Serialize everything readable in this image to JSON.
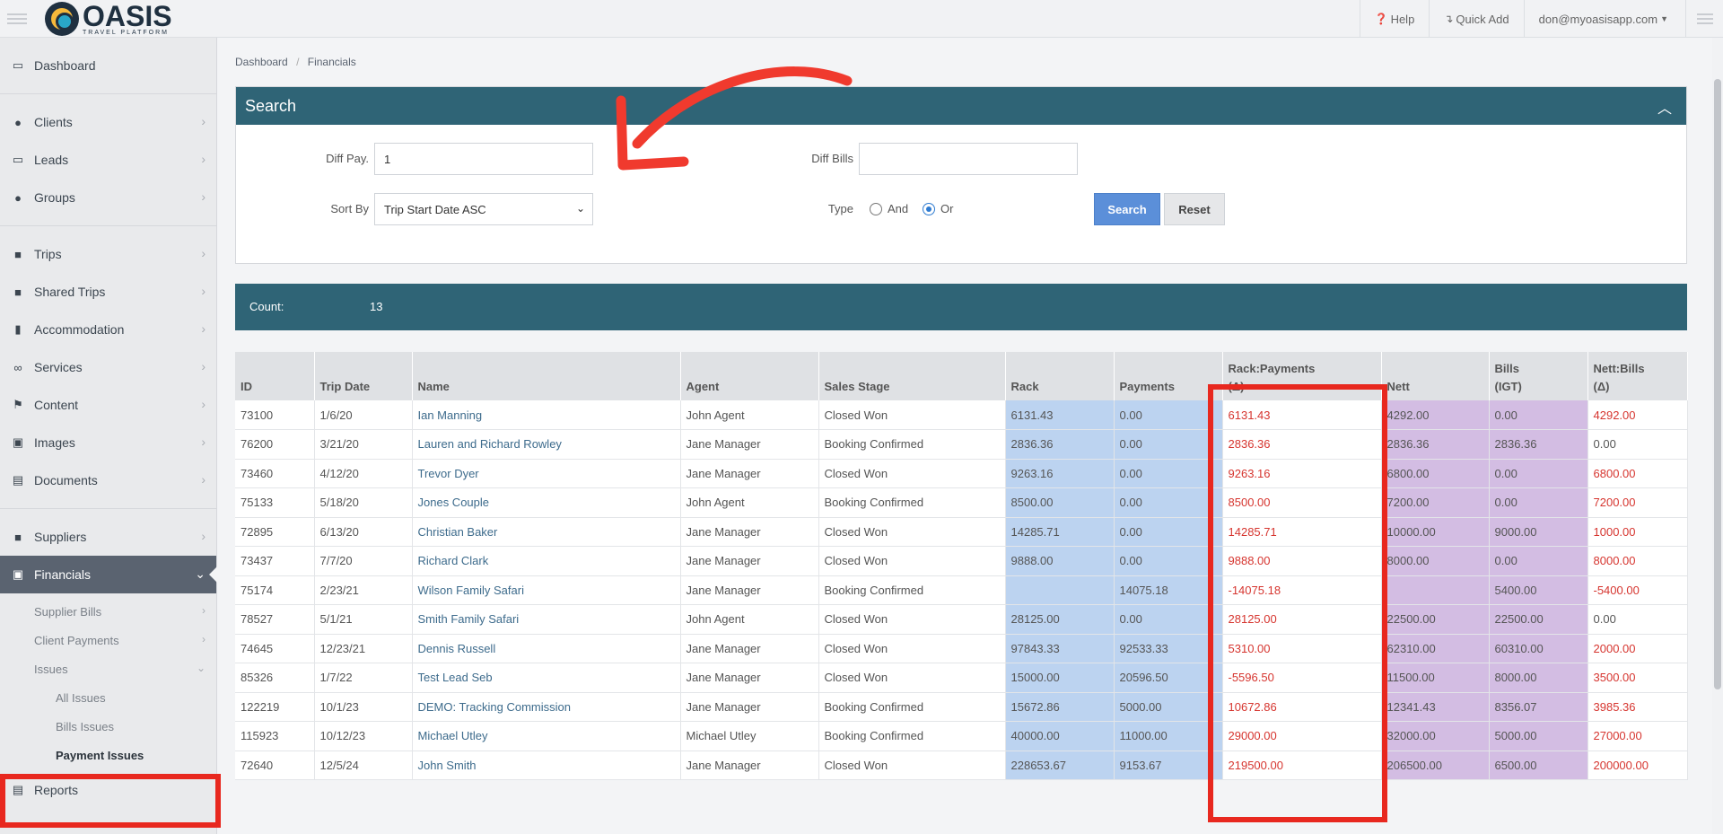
{
  "topbar": {
    "logo_word": "OASIS",
    "logo_sub": "TRAVEL PLATFORM",
    "help_label": "Help",
    "quick_add_label": "Quick Add",
    "user_email": "don@myoasisapp.com"
  },
  "sidebar": {
    "items": [
      {
        "label": "Dashboard",
        "icon": "monitor-icon"
      },
      {
        "label": "Clients",
        "icon": "user-icon"
      },
      {
        "label": "Leads",
        "icon": "inbox-icon"
      },
      {
        "label": "Groups",
        "icon": "users-icon"
      },
      {
        "label": "Trips",
        "icon": "briefcase-icon"
      },
      {
        "label": "Shared Trips",
        "icon": "briefcase-icon"
      },
      {
        "label": "Accommodation",
        "icon": "building-icon"
      },
      {
        "label": "Services",
        "icon": "binoculars-icon"
      },
      {
        "label": "Content",
        "icon": "flag-icon"
      },
      {
        "label": "Images",
        "icon": "image-icon"
      },
      {
        "label": "Documents",
        "icon": "document-icon"
      },
      {
        "label": "Suppliers",
        "icon": "truck-icon"
      },
      {
        "label": "Financials",
        "icon": "money-icon"
      },
      {
        "label": "Reports",
        "icon": "list-icon"
      }
    ],
    "sub_items": {
      "supplier_bills": "Supplier Bills",
      "client_payments": "Client Payments",
      "issues": "Issues",
      "all_issues": "All Issues",
      "bills_issues": "Bills Issues",
      "payment_issues": "Payment Issues"
    }
  },
  "breadcrumb": {
    "home": "Dashboard",
    "current": "Financials"
  },
  "search": {
    "title": "Search",
    "diff_pay_label": "Diff Pay.",
    "diff_pay_value": "1",
    "diff_bills_label": "Diff Bills",
    "diff_bills_value": "",
    "sort_by_label": "Sort By",
    "sort_by_value": "Trip Start Date ASC",
    "type_label": "Type",
    "type_and": "And",
    "type_or": "Or",
    "search_button": "Search",
    "reset_button": "Reset"
  },
  "count": {
    "label": "Count:",
    "value": "13"
  },
  "table": {
    "headers": {
      "id": "ID",
      "trip_date": "Trip Date",
      "name": "Name",
      "agent": "Agent",
      "sales_stage": "Sales Stage",
      "rack": "Rack",
      "payments": "Payments",
      "rack_payments_1": "Rack:Payments",
      "rack_payments_2": "(Δ)",
      "nett": "Nett",
      "bills_1": "Bills",
      "bills_2": "(IGT)",
      "nett_bills_1": "Nett:Bills",
      "nett_bills_2": "(Δ)"
    },
    "rows": [
      {
        "id": "73100",
        "date": "1/6/20",
        "name": "Ian Manning",
        "agent": "John Agent",
        "stage": "Closed Won",
        "rack": "6131.43",
        "pay": "0.00",
        "rp": "6131.43",
        "nett": "4292.00",
        "bills": "0.00",
        "nb": "4292.00",
        "nb_red": true
      },
      {
        "id": "76200",
        "date": "3/21/20",
        "name": "Lauren and Richard Rowley",
        "agent": "Jane Manager",
        "stage": "Booking Confirmed",
        "rack": "2836.36",
        "pay": "0.00",
        "rp": "2836.36",
        "nett": "2836.36",
        "bills": "2836.36",
        "nb": "0.00",
        "nb_red": false
      },
      {
        "id": "73460",
        "date": "4/12/20",
        "name": "Trevor Dyer",
        "agent": "Jane Manager",
        "stage": "Closed Won",
        "rack": "9263.16",
        "pay": "0.00",
        "rp": "9263.16",
        "nett": "6800.00",
        "bills": "0.00",
        "nb": "6800.00",
        "nb_red": true
      },
      {
        "id": "75133",
        "date": "5/18/20",
        "name": "Jones Couple",
        "agent": "John Agent",
        "stage": "Booking Confirmed",
        "rack": "8500.00",
        "pay": "0.00",
        "rp": "8500.00",
        "nett": "7200.00",
        "bills": "0.00",
        "nb": "7200.00",
        "nb_red": true
      },
      {
        "id": "72895",
        "date": "6/13/20",
        "name": "Christian Baker",
        "agent": "Jane Manager",
        "stage": "Closed Won",
        "rack": "14285.71",
        "pay": "0.00",
        "rp": "14285.71",
        "nett": "10000.00",
        "bills": "9000.00",
        "nb": "1000.00",
        "nb_red": true
      },
      {
        "id": "73437",
        "date": "7/7/20",
        "name": "Richard Clark",
        "agent": "Jane Manager",
        "stage": "Closed Won",
        "rack": "9888.00",
        "pay": "0.00",
        "rp": "9888.00",
        "nett": "8000.00",
        "bills": "0.00",
        "nb": "8000.00",
        "nb_red": true
      },
      {
        "id": "75174",
        "date": "2/23/21",
        "name": "Wilson Family Safari",
        "agent": "Jane Manager",
        "stage": "Booking Confirmed",
        "rack": "",
        "pay": "14075.18",
        "rp": "-14075.18",
        "nett": "",
        "bills": "5400.00",
        "nb": "-5400.00",
        "nb_red": true
      },
      {
        "id": "78527",
        "date": "5/1/21",
        "name": "Smith Family Safari",
        "agent": "John Agent",
        "stage": "Closed Won",
        "rack": "28125.00",
        "pay": "0.00",
        "rp": "28125.00",
        "nett": "22500.00",
        "bills": "22500.00",
        "nb": "0.00",
        "nb_red": false
      },
      {
        "id": "74645",
        "date": "12/23/21",
        "name": "Dennis Russell",
        "agent": "Jane Manager",
        "stage": "Closed Won",
        "rack": "97843.33",
        "pay": "92533.33",
        "rp": "5310.00",
        "nett": "62310.00",
        "bills": "60310.00",
        "nb": "2000.00",
        "nb_red": true
      },
      {
        "id": "85326",
        "date": "1/7/22",
        "name": "Test Lead Seb",
        "agent": "Jane Manager",
        "stage": "Closed Won",
        "rack": "15000.00",
        "pay": "20596.50",
        "rp": "-5596.50",
        "nett": "11500.00",
        "bills": "8000.00",
        "nb": "3500.00",
        "nb_red": true
      },
      {
        "id": "122219",
        "date": "10/1/23",
        "name": "DEMO: Tracking Commission",
        "agent": "Jane Manager",
        "stage": "Booking Confirmed",
        "rack": "15672.86",
        "pay": "5000.00",
        "rp": "10672.86",
        "nett": "12341.43",
        "bills": "8356.07",
        "nb": "3985.36",
        "nb_red": true
      },
      {
        "id": "115923",
        "date": "10/12/23",
        "name": "Michael Utley",
        "agent": "Michael Utley",
        "stage": "Booking Confirmed",
        "rack": "40000.00",
        "pay": "11000.00",
        "rp": "29000.00",
        "nett": "32000.00",
        "bills": "5000.00",
        "nb": "27000.00",
        "nb_red": true
      },
      {
        "id": "72640",
        "date": "12/5/24",
        "name": "John Smith",
        "agent": "Jane Manager",
        "stage": "Closed Won",
        "rack": "228653.67",
        "pay": "9153.67",
        "rp": "219500.00",
        "nett": "206500.00",
        "bills": "6500.00",
        "nb": "200000.00",
        "nb_red": true
      }
    ]
  },
  "colors": {
    "header_teal": "#2f6476",
    "rack_blue": "#bcd3f0",
    "nett_purple": "#d3bde3",
    "delta_red": "#d6352f",
    "annotation_red": "#e8281f"
  }
}
